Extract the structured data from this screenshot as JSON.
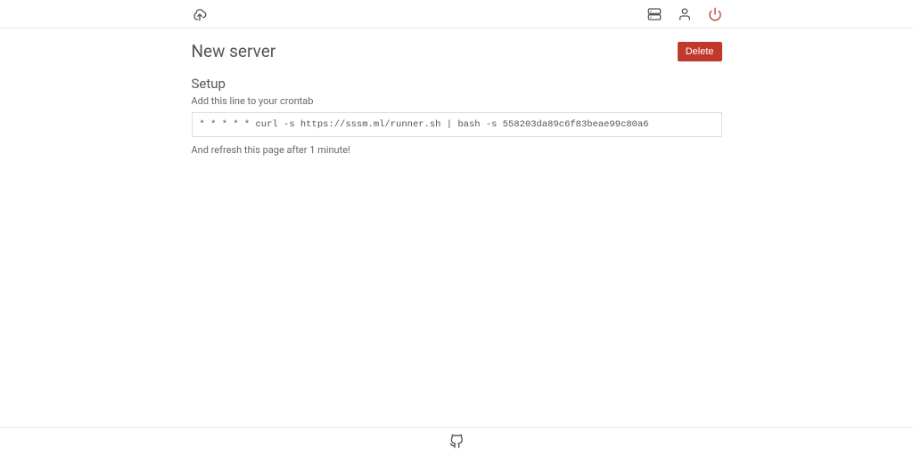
{
  "header": {
    "title": "New server",
    "delete_label": "Delete"
  },
  "setup": {
    "section_title": "Setup",
    "instruction": "Add this line to your crontab",
    "command": "* * * * * curl -s https://sssm.ml/runner.sh | bash -s 558203da89c6f83beae99c80a6",
    "footer_note": "And refresh this page after 1 minute!"
  },
  "icons": {
    "logo": "logo",
    "servers": "servers",
    "user": "user",
    "power": "power",
    "github": "github"
  }
}
